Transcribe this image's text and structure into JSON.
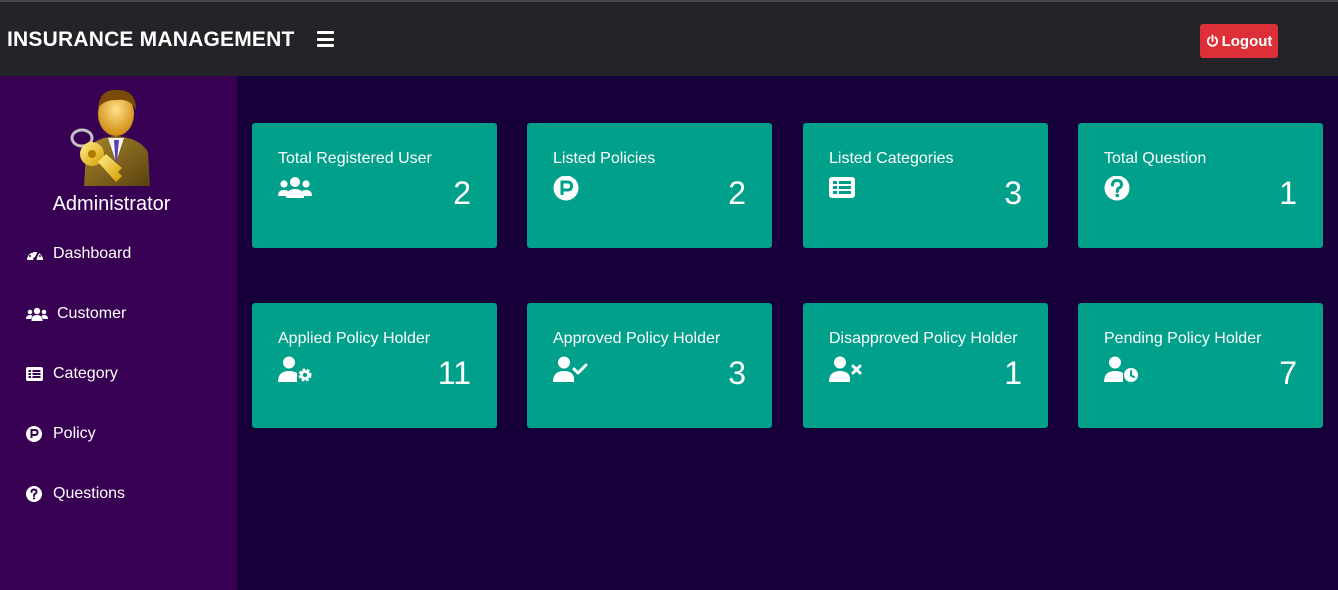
{
  "header": {
    "title": "INSURANCE MANAGEMENT",
    "menu_icon": "hamburger-icon",
    "logout_label": "Logout",
    "logout_icon": "power-icon"
  },
  "sidebar": {
    "avatar_icon": "admin-key-avatar-icon",
    "admin_name": "Administrator",
    "items": [
      {
        "label": "Dashboard",
        "icon": "dashboard-gauge-icon"
      },
      {
        "label": "Customer",
        "icon": "users-icon"
      },
      {
        "label": "Category",
        "icon": "list-icon"
      },
      {
        "label": "Policy",
        "icon": "policy-p-icon"
      },
      {
        "label": "Questions",
        "icon": "question-circle-icon"
      }
    ]
  },
  "cards": [
    {
      "title": "Total Registered User",
      "value": "2",
      "icon": "users-icon"
    },
    {
      "title": "Listed Policies",
      "value": "2",
      "icon": "policy-p-icon"
    },
    {
      "title": "Listed Categories",
      "value": "3",
      "icon": "list-icon"
    },
    {
      "title": "Total Question",
      "value": "1",
      "icon": "question-circle-icon"
    },
    {
      "title": "Applied Policy Holder",
      "value": "11",
      "icon": "user-cog-icon"
    },
    {
      "title": "Approved Policy Holder",
      "value": "3",
      "icon": "user-check-icon"
    },
    {
      "title": "Disapproved Policy Holder",
      "value": "1",
      "icon": "user-times-icon"
    },
    {
      "title": "Pending Policy Holder",
      "value": "7",
      "icon": "user-clock-icon"
    }
  ],
  "colors": {
    "topbar": "#232328",
    "sidebar": "#380052",
    "main_bg": "#17003a",
    "card": "#00a08b",
    "logout": "#dc2f37"
  }
}
